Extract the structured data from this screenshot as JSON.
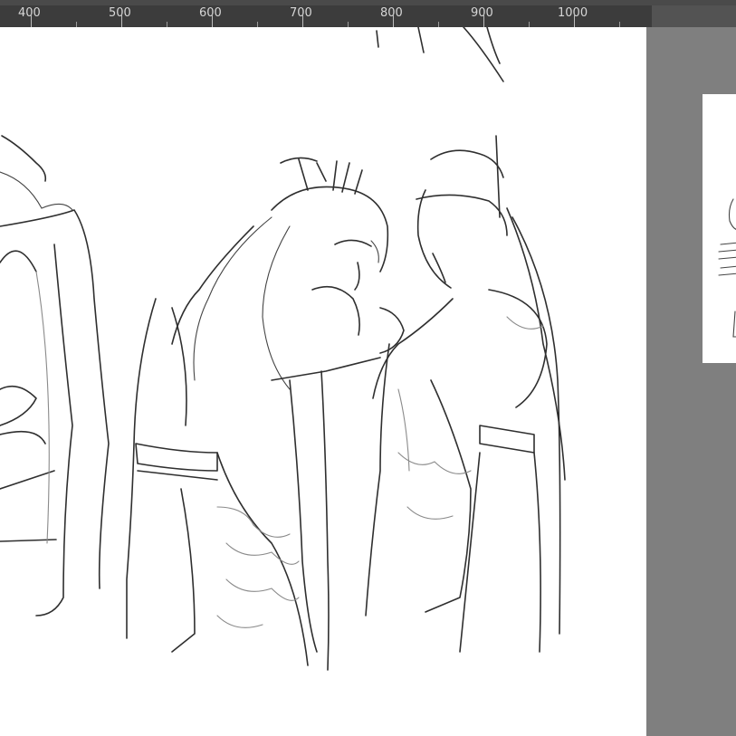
{
  "ruler": {
    "ticks": [
      "400",
      "500",
      "600",
      "700",
      "800",
      "900",
      "1000"
    ]
  },
  "canvas": {
    "content": "sketch-artwork",
    "background_color": "#ffffff"
  },
  "workspace": {
    "background_color": "#7f7f7f"
  }
}
